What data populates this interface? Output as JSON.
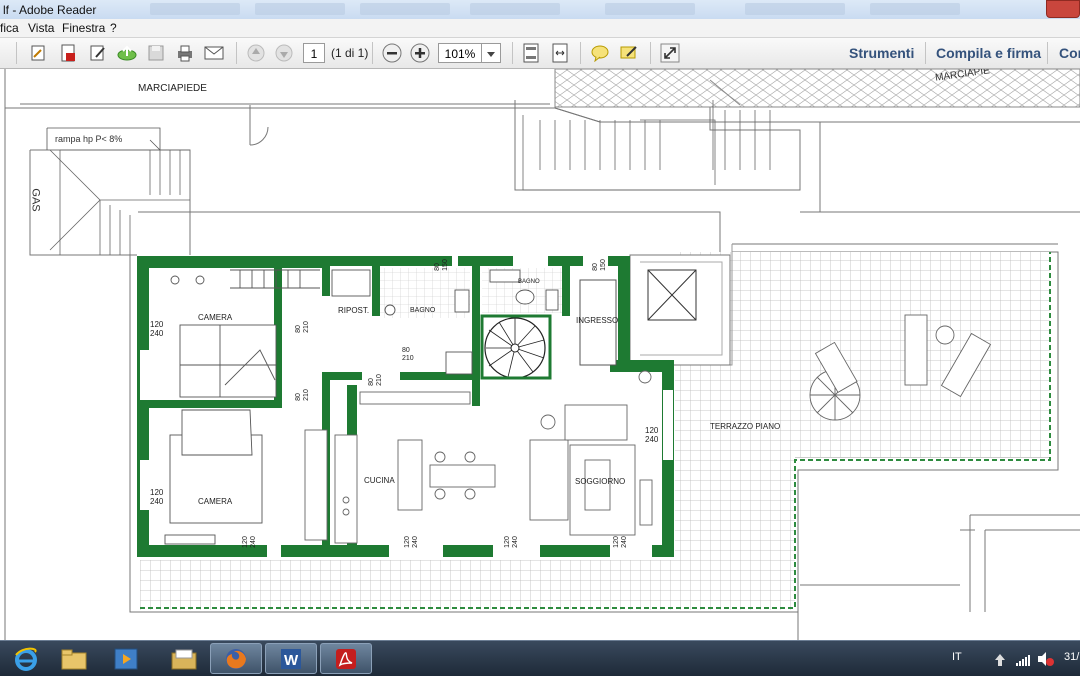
{
  "window": {
    "title": "lf - Adobe Reader"
  },
  "menu": {
    "items": [
      "fica",
      "Vista",
      "Finestra",
      "?"
    ]
  },
  "toolbar": {
    "page_current": "1",
    "page_total": "(1 di 1)",
    "zoom": "101%",
    "tools_label": "Strumenti",
    "fill_sign_label": "Compila e firma",
    "comment_label": "Cor"
  },
  "plan": {
    "sidewalk": "MARCIAPIEDE",
    "sidewalk_right": "MARCIAPIE",
    "ramp": "rampa hp P< 8%",
    "gas": "GAS",
    "room_camera_1": "CAMERA",
    "room_camera_2": "CAMERA",
    "room_ripost": "RIPOST.",
    "room_bagno_1": "BAGNO",
    "room_bagno_2": "BAGNO",
    "room_ingresso": "INGRESSO",
    "room_cucina": "CUCINA",
    "room_soggiorno": "SOGGIORNO",
    "room_terrazzo": "TERRAZZO PIANO",
    "dims": {
      "d1a": "120",
      "d1b": "240",
      "d2a": "120",
      "d2b": "240",
      "d3a": "80",
      "d3b": "210",
      "d4a": "80",
      "d4b": "210",
      "d5a": "80",
      "d5b": "210",
      "d6a": "80",
      "d6b": "210",
      "d7a": "80",
      "d7b": "150",
      "d8a": "80",
      "d8b": "150",
      "d9a": "120",
      "d9b": "240",
      "b1a": "120",
      "b1b": "240",
      "b2a": "120",
      "b2b": "240",
      "b3a": "120",
      "b3b": "240",
      "b4a": "120",
      "b4b": "240"
    }
  },
  "taskbar": {
    "language": "IT",
    "clock": "31/"
  }
}
